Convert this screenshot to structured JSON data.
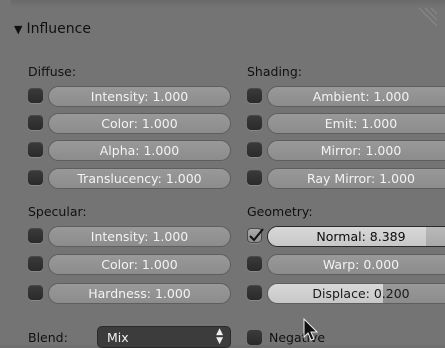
{
  "panel": {
    "title": "Influence",
    "collapse_glyph": "▼"
  },
  "diffuse": {
    "label": "Diffuse:",
    "items": [
      {
        "label": "Intensity: 1.000",
        "checked": false
      },
      {
        "label": "Color: 1.000",
        "checked": false
      },
      {
        "label": "Alpha: 1.000",
        "checked": false
      },
      {
        "label": "Translucency: 1.000",
        "checked": false
      }
    ]
  },
  "specular": {
    "label": "Specular:",
    "items": [
      {
        "label": "Intensity: 1.000",
        "checked": false
      },
      {
        "label": "Color: 1.000",
        "checked": false
      },
      {
        "label": "Hardness: 1.000",
        "checked": false
      }
    ]
  },
  "shading": {
    "label": "Shading:",
    "items": [
      {
        "label": "Ambient: 1.000",
        "checked": false
      },
      {
        "label": "Emit: 1.000",
        "checked": false
      },
      {
        "label": "Mirror: 1.000",
        "checked": false
      },
      {
        "label": "Ray Mirror: 1.000",
        "checked": false
      }
    ]
  },
  "geometry": {
    "label": "Geometry:",
    "items": [
      {
        "label": "Normal: 8.389",
        "checked": true,
        "fill": 0.85
      },
      {
        "label": "Warp: 0.000",
        "checked": false,
        "fill": 0.0
      },
      {
        "label": "Displace: 0.200",
        "checked": false,
        "fill": 0.62
      }
    ]
  },
  "blend": {
    "label": "Blend:",
    "value": "Mix",
    "arrows": "▲▼"
  },
  "negative": {
    "label": "Negative",
    "checked": false
  }
}
